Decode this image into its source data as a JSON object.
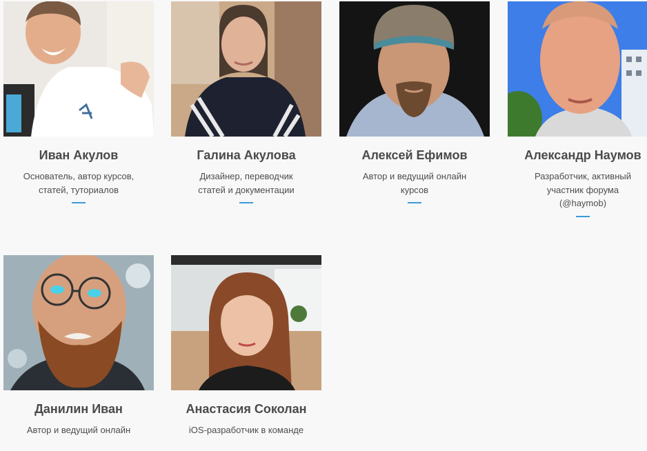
{
  "team": [
    {
      "name": "Иван Акулов",
      "role_lines": [
        "Основатель, автор курсов,",
        "статей, туториалов"
      ],
      "photo_icon": "portrait-ivan-akulov"
    },
    {
      "name": "Галина Акулова",
      "role_lines": [
        "Дизайнер, переводчик",
        "статей и документации"
      ],
      "photo_icon": "portrait-galina-akulova"
    },
    {
      "name": "Алексей Ефимов",
      "role_lines": [
        "Автор и ведущий онлайн",
        "курсов"
      ],
      "photo_icon": "portrait-alexey-efimov"
    },
    {
      "name": "Александр Наумов",
      "role_lines": [
        "Разработчик, активный",
        "участник форума",
        "(@haymob)"
      ],
      "photo_icon": "portrait-alexander-naumov"
    },
    {
      "name": "Данилин Иван",
      "role_lines": [
        "Автор и ведущий онлайн"
      ],
      "photo_icon": "portrait-danilin-ivan"
    },
    {
      "name": "Анастасия Соколан",
      "role_lines": [
        "iOS-разработчик в команде"
      ],
      "photo_icon": "portrait-anastasia-sokolan"
    }
  ],
  "colors": {
    "accent": "#3a9ad9",
    "name_text": "#4a4a4a",
    "role_text": "#4d4d4d",
    "background": "#f8f8f8"
  }
}
